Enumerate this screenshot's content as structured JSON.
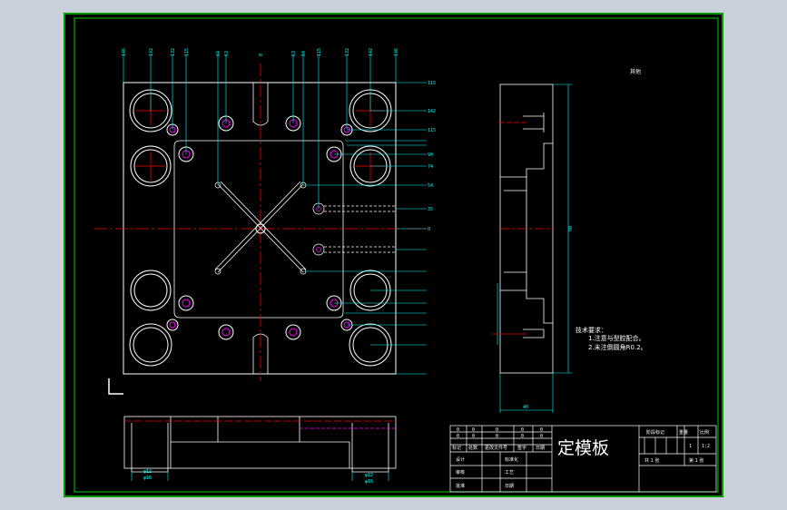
{
  "tech": {
    "label_top": "其他",
    "title": "技术要求：",
    "line1": "1.注意与型腔配合。",
    "line2": "2.未注倒圆角R0.2。"
  },
  "title_block": {
    "part_name": "定模板",
    "zero": "0",
    "row_labels": [
      "标记",
      "处数",
      "更改文件号",
      "签字",
      "日期"
    ],
    "design": "设计",
    "check": "审核",
    "std": "标准化",
    "craft": "工艺",
    "approve": "批准",
    "date": "日期",
    "stage_label": "阶段标记",
    "weight_label": "重量",
    "scale_label": "比例",
    "scale_value": "1:2",
    "count_one": "1",
    "sheets_total": "共 1 张",
    "sheet_no": "第 1 张"
  },
  "dims": {
    "right_top": "115",
    "right_a": "142",
    "right_b": "115",
    "right_c": "90",
    "right_d": "74",
    "right_e": "54",
    "right_f": "35",
    "right_g": "0",
    "side_height": "90",
    "side_width": "40",
    "phi_top": "φ12",
    "phi_bottom": "φ16",
    "top_labels": [
      "146",
      "142",
      "132",
      "115",
      "84",
      "63",
      "0",
      "63",
      "84",
      "115",
      "132",
      "142",
      "146"
    ]
  },
  "colors": {
    "background": "#000000",
    "frame": "#00ff00",
    "outline": "#ffffff",
    "center": "#ff0000",
    "dim": "#00ffff",
    "hole": "#ff00ff",
    "title_text": "#ffffff"
  }
}
